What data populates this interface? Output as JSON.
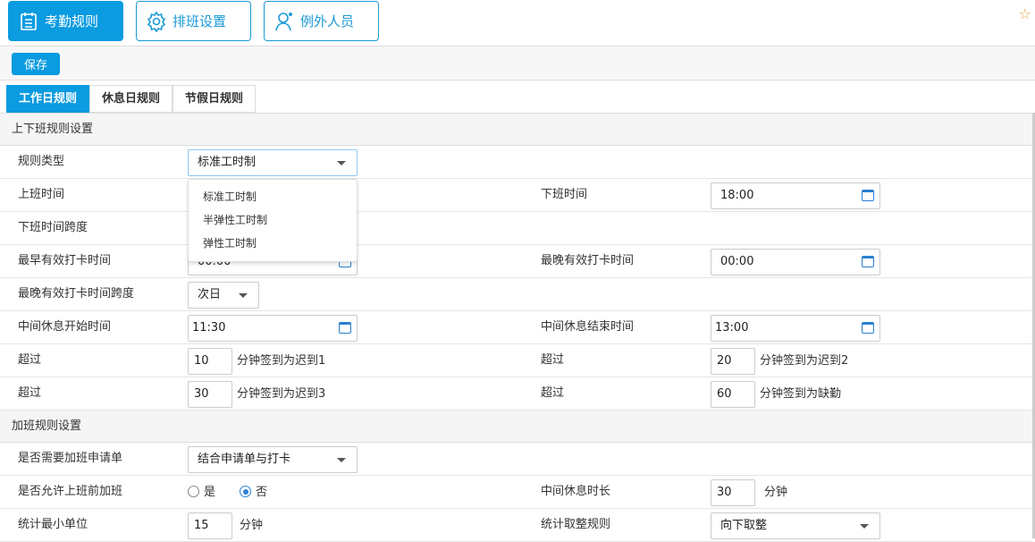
{
  "top_tabs": [
    {
      "label": "考勤规则",
      "icon": "calendar-icon"
    },
    {
      "label": "排班设置",
      "icon": "gear-icon"
    },
    {
      "label": "例外人员",
      "icon": "user-icon"
    }
  ],
  "toolbar": {
    "save_label": "保存"
  },
  "sub_tabs": [
    "工作日规则",
    "休息日规则",
    "节假日规则"
  ],
  "section1": {
    "title": "上下班规则设置",
    "rule_type": {
      "label": "规则类型",
      "value": "标准工时制",
      "options": [
        "标准工时制",
        "半弹性工时制",
        "弹性工时制"
      ]
    },
    "start_time": {
      "label": "上班时间"
    },
    "end_time": {
      "label": "下班时间",
      "value": "18:00"
    },
    "end_span": {
      "label": "下班时间跨度"
    },
    "earliest": {
      "label": "最早有效打卡时间",
      "value": "00:00"
    },
    "latest": {
      "label": "最晚有效打卡时间",
      "value": "00:00"
    },
    "latest_span": {
      "label": "最晚有效打卡时间跨度",
      "value": "次日"
    },
    "break_start": {
      "label": "中间休息开始时间",
      "value": "11:30"
    },
    "break_end": {
      "label": "中间休息结束时间",
      "value": "13:00"
    },
    "late1": {
      "label": "超过",
      "value": "10",
      "unit": "分钟签到为迟到1"
    },
    "late2": {
      "label": "超过",
      "value": "20",
      "unit": "分钟签到为迟到2"
    },
    "late3": {
      "label": "超过",
      "value": "30",
      "unit": "分钟签到为迟到3"
    },
    "absent": {
      "label": "超过",
      "value": "60",
      "unit": "分钟签到为缺勤"
    }
  },
  "section2": {
    "title": "加班规则设置",
    "need_apply": {
      "label": "是否需要加班申请单",
      "value": "结合申请单与打卡"
    },
    "allow_before": {
      "label": "是否允许上班前加班",
      "yes": "是",
      "no": "否",
      "selected": "否"
    },
    "break_len": {
      "label": "中间休息时长",
      "value": "30",
      "unit": "分钟"
    },
    "min_unit": {
      "label": "统计最小单位",
      "value": "15",
      "unit": "分钟"
    },
    "rounding": {
      "label": "统计取整规则",
      "value": "向下取整"
    }
  }
}
